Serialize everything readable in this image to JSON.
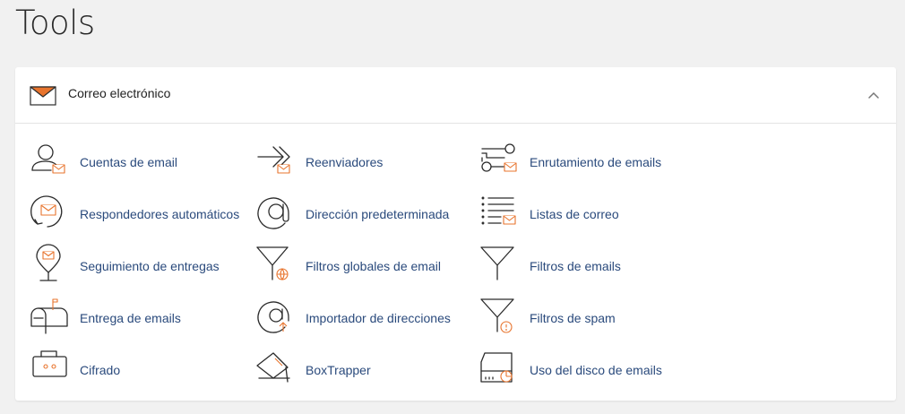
{
  "page": {
    "title": "Tools"
  },
  "section": {
    "title": "Correo electrónico",
    "header_icon": "envelope-icon",
    "collapse_icon": "chevron-up-icon",
    "accent_color": "#e8742d",
    "link_color": "#2a4a7c"
  },
  "tools": [
    {
      "label": "Cuentas de email",
      "icon": "email-accounts-icon"
    },
    {
      "label": "Reenviadores",
      "icon": "forwarders-icon"
    },
    {
      "label": "Enrutamiento de emails",
      "icon": "email-routing-icon"
    },
    {
      "label": "Respondedores automáticos",
      "icon": "autoresponders-icon"
    },
    {
      "label": "Dirección predeterminada",
      "icon": "default-address-icon"
    },
    {
      "label": "Listas de correo",
      "icon": "mailing-lists-icon"
    },
    {
      "label": "Seguimiento de entregas",
      "icon": "track-delivery-icon"
    },
    {
      "label": "Filtros globales de email",
      "icon": "global-filters-icon"
    },
    {
      "label": "Filtros de emails",
      "icon": "email-filters-icon"
    },
    {
      "label": "Entrega de emails",
      "icon": "email-deliverability-icon"
    },
    {
      "label": "Importador de direcciones",
      "icon": "address-importer-icon"
    },
    {
      "label": "Filtros de spam",
      "icon": "spam-filters-icon"
    },
    {
      "label": "Cifrado",
      "icon": "encryption-icon"
    },
    {
      "label": "BoxTrapper",
      "icon": "boxtrapper-icon"
    },
    {
      "label": "Uso del disco de emails",
      "icon": "email-disk-usage-icon"
    }
  ]
}
